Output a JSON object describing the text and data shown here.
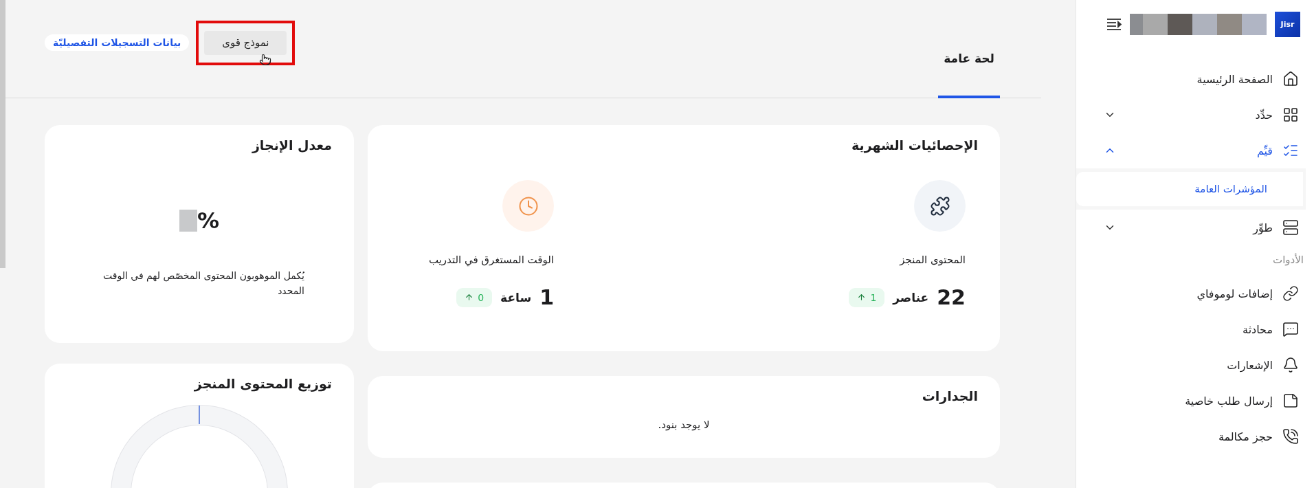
{
  "sidebar": {
    "logo": "Jisr",
    "nav": [
      {
        "kind": "link",
        "label": "الصفحة الرئيسية"
      },
      {
        "kind": "group",
        "label": "حدِّد",
        "expanded": false
      },
      {
        "kind": "group",
        "label": "قيِّم",
        "expanded": true,
        "children": [
          {
            "label": "المؤشرات العامة",
            "selected": true
          }
        ]
      },
      {
        "kind": "group",
        "label": "طوِّر",
        "expanded": false
      }
    ],
    "tools_heading": "الأدوات",
    "tools": [
      {
        "label": "إضافات لوموفاي"
      },
      {
        "label": "محادثة"
      },
      {
        "label": "الإشعارات"
      },
      {
        "label": "إرسال طلب خاصية"
      },
      {
        "label": "حجز مكالمة"
      }
    ]
  },
  "header": {
    "tabs": [
      {
        "label": "لحة عامة",
        "selected": true
      }
    ],
    "actions": [
      {
        "kind": "button",
        "label": "نموذج قوى",
        "highlighted": true
      },
      {
        "kind": "link",
        "label": "بيانات التسجيلات التفصيليّة"
      }
    ]
  },
  "monthly_stats": {
    "title": "الإحصائيات الشهرية",
    "items": [
      {
        "label": "المحتوى المنجز",
        "value": "22",
        "unit": "عناصر",
        "change": "1"
      },
      {
        "label": "الوقت المستغرق في التدريب",
        "value": "1",
        "unit": "ساعة",
        "change": "0"
      }
    ]
  },
  "completion_rate": {
    "title": "معدل الإنجاز",
    "value_suffix": "%",
    "description": "يُكمل الموهوبون المحتوى المخصّص لهم في الوقت المحدد"
  },
  "competencies": {
    "title": "الجدارات",
    "empty_text": "لا يوجد بنود."
  },
  "content_distribution": {
    "title": "توزيع المحتوى المنجز"
  }
}
